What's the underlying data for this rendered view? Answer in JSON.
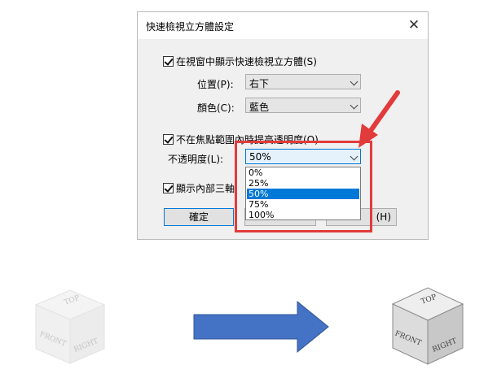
{
  "dialog": {
    "title": "快速檢視立方體設定",
    "show_cube_label": "在視窗中顯示快速檢視立方體(S)",
    "position_label": "位置(P):",
    "position_value": "右下",
    "color_label": "顏色(C):",
    "color_value": "藍色",
    "transparency_checkbox_label": "不在焦點範圍內時提高透明度(O)",
    "opacity_label": "不透明度(L):",
    "opacity_value": "50%",
    "opacity_options": [
      "0%",
      "25%",
      "50%",
      "75%",
      "100%"
    ],
    "opacity_selected_index": 2,
    "show_axes_label": "顯示內部三軸",
    "ok_label": "確定",
    "cancel_label": "(H)"
  },
  "cube": {
    "top": "TOP",
    "front": "FRONT",
    "right": "RIGHT"
  },
  "colors": {
    "annotation_red": "#e23b3b",
    "arrow_blue": "#4472c4",
    "selection_blue": "#0078d7"
  }
}
